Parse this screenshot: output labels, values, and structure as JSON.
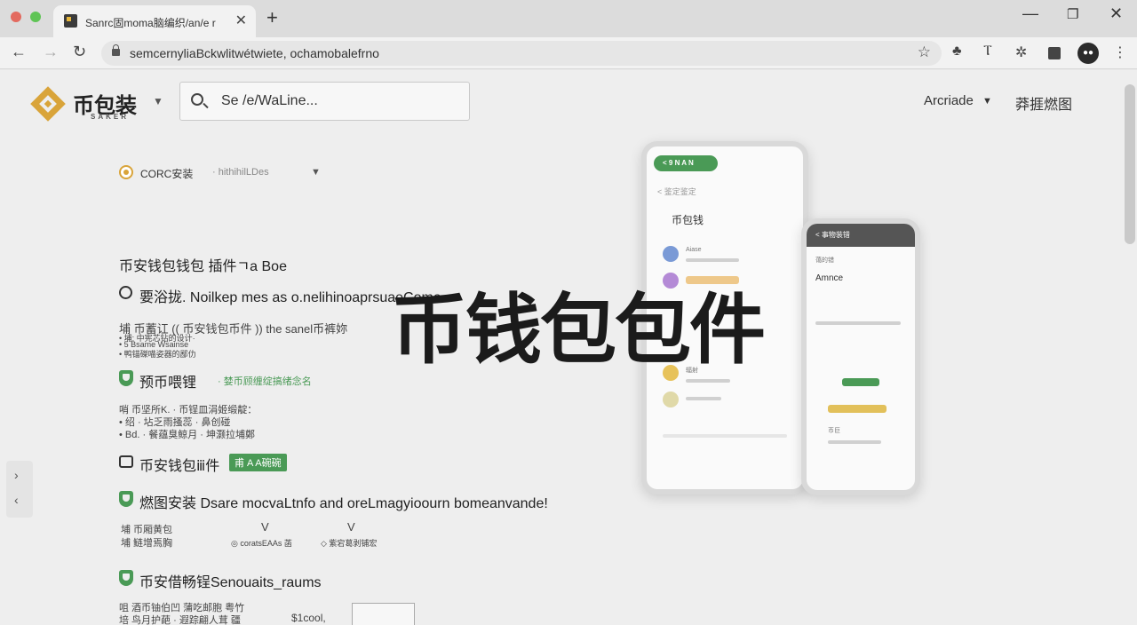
{
  "browser": {
    "tab_title": "Sanrc固moma脑编织/an/e r",
    "close_tab": "✕",
    "new_tab": "+",
    "url": "semcernyliaBckwlitwétwiete, ochamobalefrno",
    "window": {
      "minimize": "—",
      "maximize": "❐",
      "close": "✕"
    }
  },
  "header": {
    "brand": "币包装",
    "brand_sub": "SAKER",
    "search_placeholder": "Se /e/WaLine...",
    "nav_link_1": "Arcriade",
    "nav_link_2": "莽捱燃图"
  },
  "selector": {
    "label": "CORC安装",
    "value": "· hithihilLDes"
  },
  "content": {
    "heading": "币安钱包钱包 插件ㄱa Boe",
    "feature_1_title": "要浴拢. Noilkep mes as o.nelihinoaprsuaeComa",
    "feature_1_line_1": "埔 币蓄讧  (( 币安钱包币件 )) the sanel币裤妳",
    "feature_1_line_2": "• 埔: 中宪芯钻的设计·",
    "feature_1_line_3": "• 5 Bsame Wsainse",
    "feature_1_line_4": "• 鸭锚磔喵姿器的鄙仂",
    "feature_2_title": "预币喂锂",
    "feature_2_sub": "· 婪币顾缠绽搞绪念名",
    "feature_2_line_1": "哨 币坚所K. · 币锃皿涓姬缎靛：",
    "feature_2_line_2": "• 绍 · 坫乏雨搔蕊 · 鼻创碰",
    "feature_2_line_3": "• Bd. · 餐蕴臭鲸月 · 坤灏拉埔鄭",
    "feature_3_title": "币安钱包ⅲ件",
    "feature_3_tag": "甫 A A碗碗",
    "feature_4_title": "燃图安装 Dsare mocvaLtnfo and oreLmagyioourn bomeanvande!",
    "feature_4_col_1_line_1": "埔 币厢黄包",
    "feature_4_col_1_line_2": "埔 鲢增焉胸",
    "feature_4_col_2_label": "V",
    "feature_4_col_2_text": "◎ coratsEAAs 菡",
    "feature_4_col_3_label": "V",
    "feature_4_col_3_text": "◇ 紫宕葛剥铺宏",
    "feature_5_title": "币安借畅锃Senouaits_raums",
    "feature_5_line_1": "咀 酒币铀伯凹 蒲吃邮胞 粤竹",
    "feature_5_line_2": "培 鸟月护葩 · 遐踪翩人茸 疆",
    "feature_5_value": "$1cool,",
    "overlay_text": "币钱包包件"
  },
  "phone_1": {
    "pill": "< 9 N A N",
    "back_text": "< 鉴定鉴定",
    "title": "币包钱",
    "item_1": "Aiase",
    "item_2": "辐射"
  },
  "phone_2": {
    "header": "< 事物装错",
    "sub": "蔼的错",
    "title": "Amnce",
    "item": "币巨"
  },
  "colors": {
    "brand_gold": "#d9a43a",
    "accent_green": "#4a9a56",
    "page_bg": "#eeeeee"
  },
  "icons": [
    "search-icon",
    "lock-icon",
    "star-icon",
    "shield-icon",
    "chevron-down-icon",
    "profile-avatar",
    "chevron-left-icon",
    "chevron-right-icon"
  ]
}
